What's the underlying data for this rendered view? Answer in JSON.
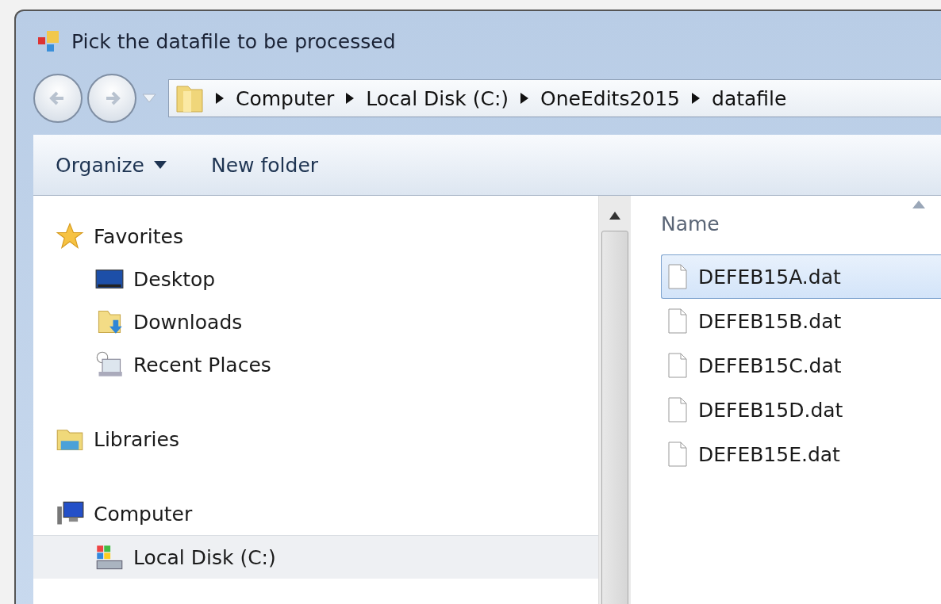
{
  "window": {
    "title": "Pick the datafile to be processed"
  },
  "breadcrumb": [
    "Computer",
    "Local Disk (C:)",
    "OneEdits2015",
    "datafile"
  ],
  "toolbar": {
    "organize": "Organize",
    "new_folder": "New folder"
  },
  "nav_tree": [
    {
      "label": "Favorites",
      "kind": "favorites",
      "selected": false,
      "children": [
        {
          "label": "Desktop",
          "kind": "desktop",
          "selected": false
        },
        {
          "label": "Downloads",
          "kind": "downloads",
          "selected": false
        },
        {
          "label": "Recent Places",
          "kind": "recent",
          "selected": false
        }
      ]
    },
    {
      "label": "Libraries",
      "kind": "libraries",
      "selected": false
    },
    {
      "label": "Computer",
      "kind": "computer",
      "selected": false,
      "children": [
        {
          "label": "Local Disk (C:)",
          "kind": "disk",
          "selected": true
        }
      ]
    }
  ],
  "file_list": {
    "columns": [
      "Name"
    ],
    "rows": [
      {
        "name": "DEFEB15A.dat",
        "selected": true
      },
      {
        "name": "DEFEB15B.dat",
        "selected": false
      },
      {
        "name": "DEFEB15C.dat",
        "selected": false
      },
      {
        "name": "DEFEB15D.dat",
        "selected": false
      },
      {
        "name": "DEFEB15E.dat",
        "selected": false
      }
    ]
  }
}
